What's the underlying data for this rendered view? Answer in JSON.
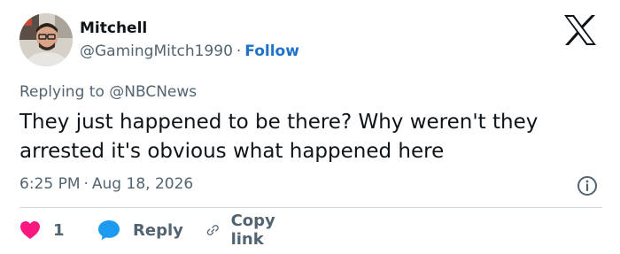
{
  "author": {
    "name": "Mitchell",
    "handle": "@GamingMitch1990",
    "separator": "·",
    "follow_label": "Follow"
  },
  "reply_context": {
    "prefix": "Replying to",
    "mention": "@NBCNews"
  },
  "tweet": {
    "text": "They just happened to be there? Why weren't they arrested it's obvious what happened here"
  },
  "meta": {
    "time": "6:25 PM",
    "separator": "·",
    "date": "Aug 18, 2026"
  },
  "actions": {
    "like_count": "1",
    "reply_label": "Reply",
    "copy_label": "Copy link"
  },
  "icons": {
    "brand": "x-logo-icon",
    "info": "info-icon",
    "like": "heart-icon",
    "reply": "speech-bubble-icon",
    "copy": "link-icon"
  },
  "colors": {
    "follow": "#1d73c9",
    "heart": "#f91880",
    "reply_bubble": "#1d9bf0",
    "secondary_text": "#536471",
    "divider": "#cfd9de"
  }
}
